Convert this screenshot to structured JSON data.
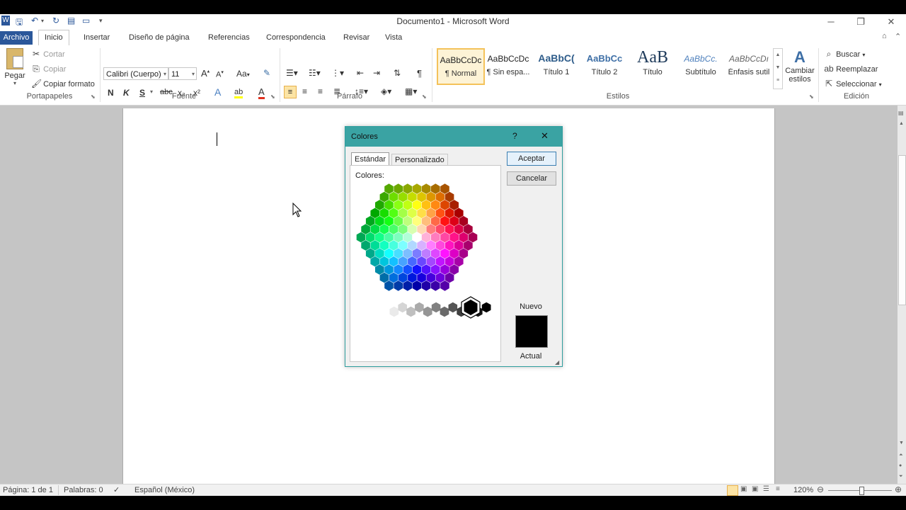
{
  "app": {
    "title": "Documento1 - Microsoft Word",
    "window_controls": [
      "─",
      "❐",
      "✕"
    ]
  },
  "tabs": [
    "Archivo",
    "Inicio",
    "Insertar",
    "Diseño de página",
    "Referencias",
    "Correspondencia",
    "Revisar",
    "Vista"
  ],
  "ribbon": {
    "clipboard": {
      "paste_label": "Pegar",
      "cut": "Cortar",
      "copy": "Copiar",
      "format_painter": "Copiar formato",
      "group_label": "Portapapeles"
    },
    "font": {
      "family": "Calibri (Cuerpo)",
      "size": "11",
      "group_label": "Fuente",
      "bold": "N",
      "italic": "K",
      "underline": "S",
      "strike": "abc",
      "subscript": "x₂",
      "superscript": "x²",
      "change_case": "Aa",
      "font_color": "A",
      "highlight": "ab"
    },
    "paragraph": {
      "group_label": "Párrafo",
      "show_marks": "¶"
    },
    "styles": {
      "group_label": "Estilos",
      "items": [
        {
          "sample": "AaBbCcDc",
          "name": "¶ Normal"
        },
        {
          "sample": "AaBbCcDc",
          "name": "¶ Sin espa..."
        },
        {
          "sample": "AaBbC(",
          "name": "Título 1"
        },
        {
          "sample": "AaBbCc",
          "name": "Título 2"
        },
        {
          "sample": "AaB",
          "name": "Título"
        },
        {
          "sample": "AaBbCc.",
          "name": "Subtítulo"
        },
        {
          "sample": "AaBbCcDı",
          "name": "Énfasis sutil"
        }
      ],
      "change_styles": "Cambiar estilos"
    },
    "editing": {
      "group_label": "Edición",
      "find": "Buscar",
      "replace": "Reemplazar",
      "select": "Seleccionar"
    }
  },
  "status_bar": {
    "page": "Página: 1 de 1",
    "words": "Palabras: 0",
    "language": "Español (México)",
    "zoom": "120%"
  },
  "dialog": {
    "title": "Colores",
    "help": "?",
    "close": "✕",
    "tabs": [
      "Estándar",
      "Personalizado"
    ],
    "colors_label": "Colores:",
    "ok": "Aceptar",
    "cancel": "Cancelar",
    "new_label": "Nuevo",
    "current_label": "Actual",
    "selected_color": "#000000",
    "accent": "#3aa3a3"
  }
}
